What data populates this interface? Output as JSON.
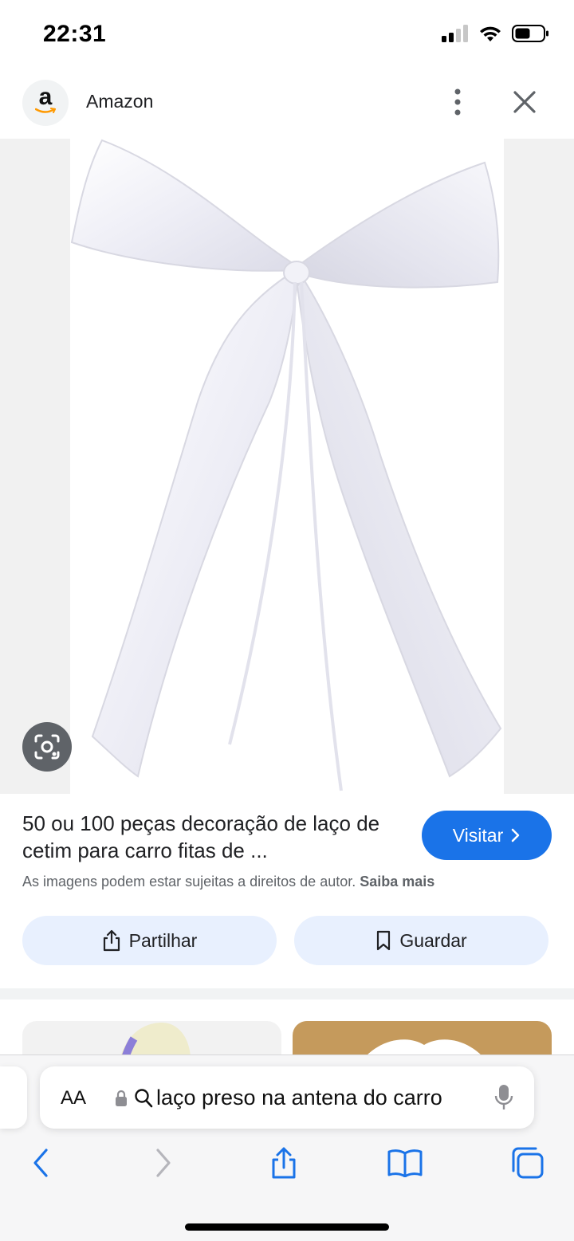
{
  "status": {
    "time": "22:31"
  },
  "source": {
    "avatar_letter": "a",
    "name": "Amazon",
    "more_icon": "more-vert-icon",
    "close_icon": "close-icon"
  },
  "image": {
    "description_icon": "lens-icon"
  },
  "result": {
    "title": "50 ou 100 peças decoração de laço de cetim para carro fitas de ...",
    "visit_label": "Visitar",
    "copyright_text": "As imagens podem estar sujeitas a direitos de autor.",
    "learn_more": "Saiba mais",
    "share_label": "Partilhar",
    "save_label": "Guardar",
    "colors": {
      "visit_button": "#1a73e8",
      "action_button_bg": "#e8f0fe"
    }
  },
  "safari": {
    "text_size_label": "AA",
    "query": "laço preso na antena do carro",
    "toolbar_icons": [
      "back-icon",
      "forward-icon",
      "share-icon",
      "bookmarks-icon",
      "tabs-icon"
    ]
  }
}
